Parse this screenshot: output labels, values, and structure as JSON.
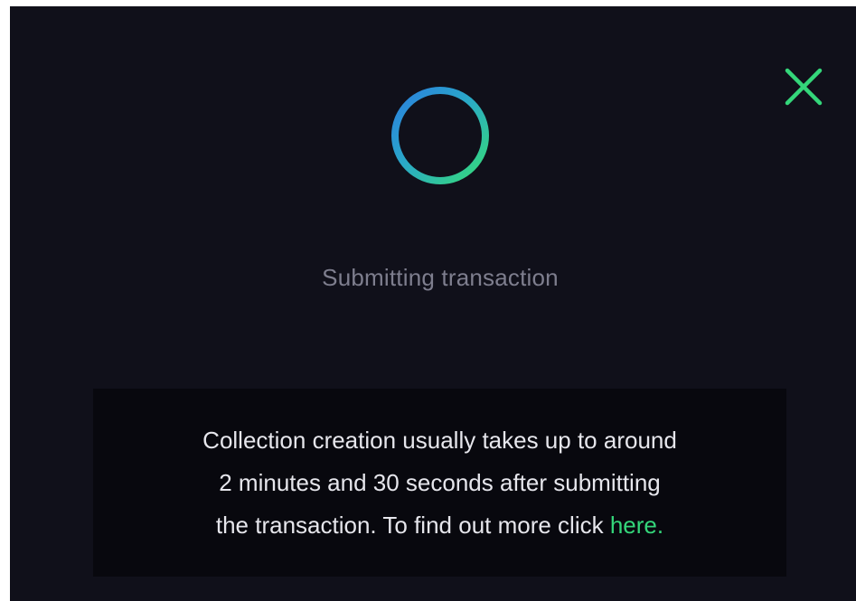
{
  "modal": {
    "close_icon": "close-icon",
    "spinner_icon": "loading-spinner-icon",
    "status": "Submitting transaction",
    "info": {
      "line1": "Collection creation usually takes up to around",
      "line2": "2 minutes and 30 seconds after submitting",
      "line3_prefix": "the transaction. To find out more click ",
      "link_text": "here."
    }
  },
  "colors": {
    "background": "#10101a",
    "info_box": "#08080e",
    "accent_green": "#34d67a",
    "accent_blue": "#2f8fe0",
    "status_text": "#7e7e8e",
    "body_text": "#e6e6ec"
  }
}
